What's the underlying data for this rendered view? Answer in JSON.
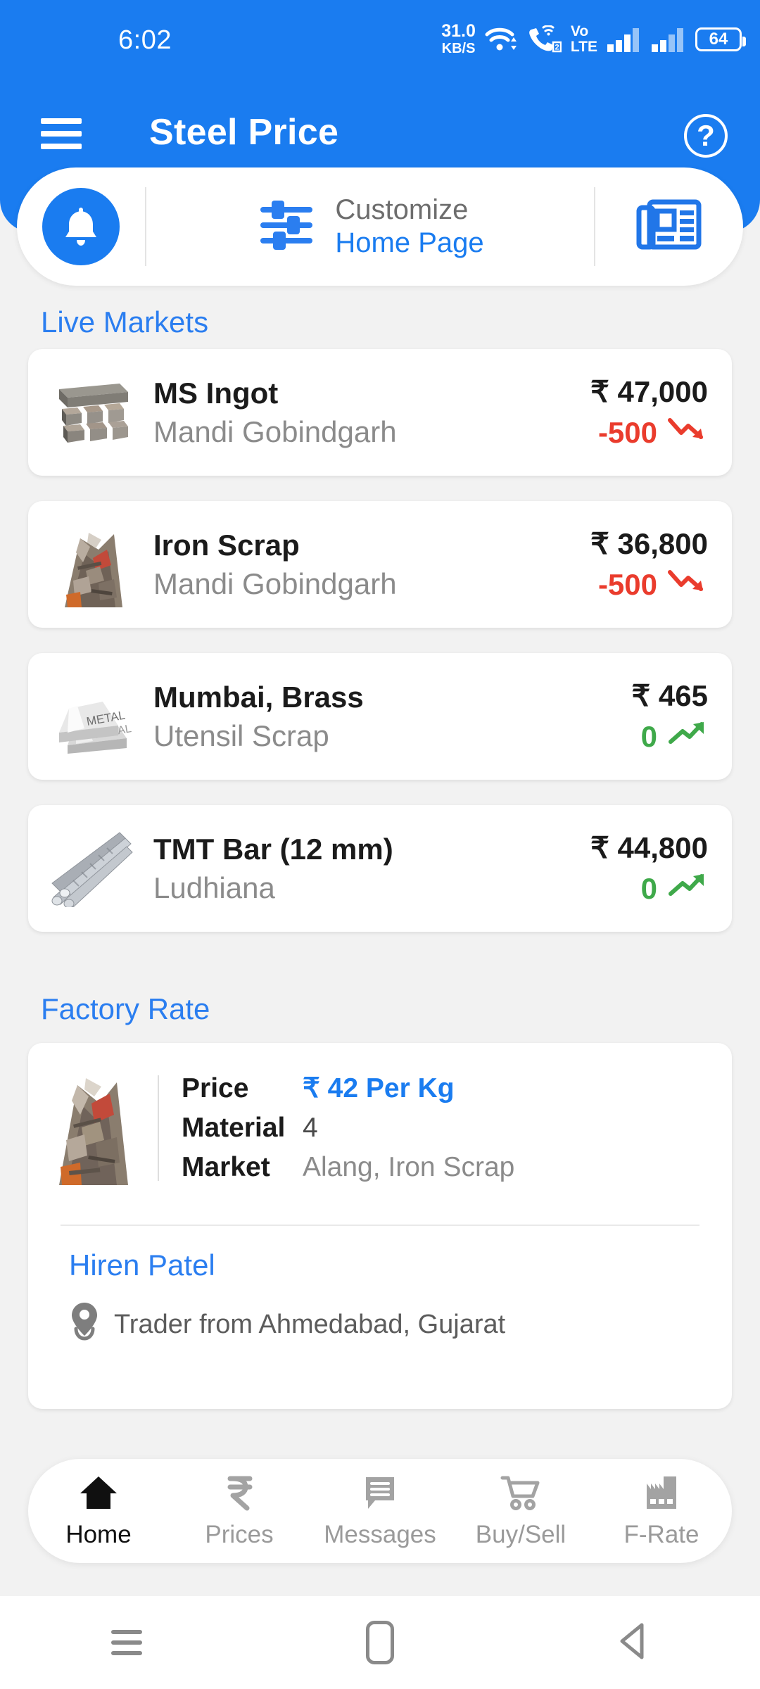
{
  "status_bar": {
    "time": "6:02",
    "net_speed_value": "31.0",
    "net_speed_unit": "KB/S",
    "sim_badge": "2",
    "volte_line1": "Vo",
    "volte_line2": "LTE",
    "battery_percent": "64"
  },
  "app_bar": {
    "title": "Steel Price",
    "help_label": "?"
  },
  "quick_actions": {
    "bell_label": "Notifications",
    "customize_line1": "Customize",
    "customize_line2": "Home Page",
    "news_label": "News"
  },
  "sections": {
    "live_markets_title": "Live Markets",
    "factory_rate_title": "Factory Rate"
  },
  "live_markets": [
    {
      "name": "MS Ingot",
      "location": "Mandi Gobindgarh",
      "price": "₹ 47,000",
      "change": "-500",
      "direction": "down"
    },
    {
      "name": "Iron Scrap",
      "location": "Mandi Gobindgarh",
      "price": "₹ 36,800",
      "change": "-500",
      "direction": "down"
    },
    {
      "name": "Mumbai, Brass",
      "location": "Utensil Scrap",
      "price": "₹ 465",
      "change": "0",
      "direction": "up"
    },
    {
      "name": "TMT Bar (12 mm)",
      "location": "Ludhiana",
      "price": "₹ 44,800",
      "change": "0",
      "direction": "up"
    }
  ],
  "factory_rate": {
    "price_label": "Price",
    "price_value": "₹ 42 Per Kg",
    "material_label": "Material",
    "material_value": "4",
    "market_label": "Market",
    "market_value": "Alang, Iron Scrap",
    "trader_name": "Hiren Patel",
    "trader_location": "Trader from Ahmedabad, Gujarat"
  },
  "bottom_nav": [
    {
      "label": "Home",
      "icon": "home-icon",
      "active": true
    },
    {
      "label": "Prices",
      "icon": "rupee-icon",
      "active": false
    },
    {
      "label": "Messages",
      "icon": "chat-icon",
      "active": false
    },
    {
      "label": "Buy/Sell",
      "icon": "cart-icon",
      "active": false
    },
    {
      "label": "F-Rate",
      "icon": "factory-icon",
      "active": false
    }
  ],
  "system_nav": {
    "recent_label": "Recent apps",
    "home_label": "Home",
    "back_label": "Back"
  },
  "colors": {
    "brand_blue": "#1a7cf0",
    "link_blue": "#2b7ef0",
    "down_red": "#ea3c2d",
    "up_green": "#3fa94a",
    "page_bg": "#f2f2f2"
  }
}
